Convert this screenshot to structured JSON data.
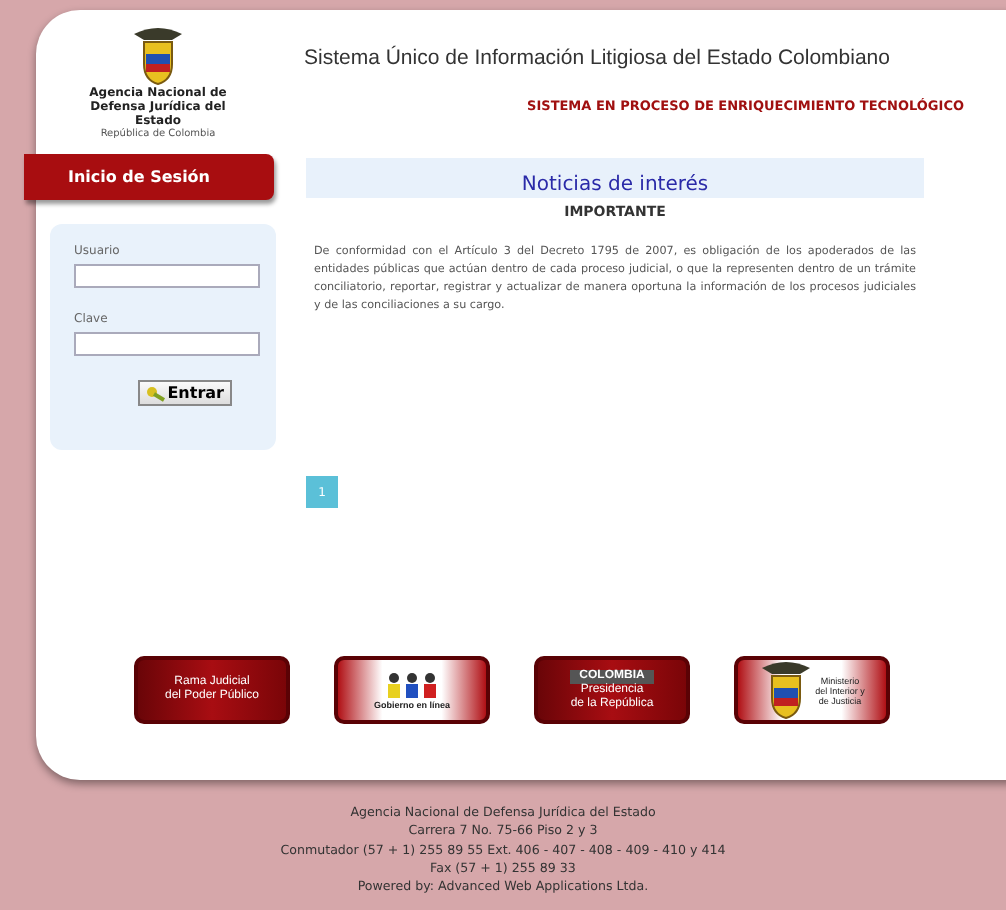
{
  "header": {
    "agency_name": "Agencia Nacional de Defensa Jurídica del Estado",
    "country": "República de Colombia",
    "title": "Sistema Único de Información Litigiosa del Estado Colombiano",
    "notice": "SISTEMA EN PROCESO DE ENRIQUECIMIENTO TECNOLÓGICO"
  },
  "login": {
    "title": "Inicio de Sesión",
    "fields": [
      {
        "label": "Usuario"
      },
      {
        "label": "Clave"
      }
    ],
    "button": "Entrar"
  },
  "news": {
    "title": "Noticias de interés",
    "heading": "IMPORTANTE",
    "body": "De conformidad con el Artículo 3 del Decreto 1795 de 2007, es obligación de los apoderados de las entidades públicas que actúan dentro de cada proceso judicial, o que la representen dentro de un trámite conciliatorio, reportar, registrar y actualizar de manera oportuna la información de los procesos judiciales y de las conciliaciones a su cargo.",
    "pages": [
      {
        "label": "1",
        "selected": true
      }
    ]
  },
  "banners": [
    {
      "kind": "photo",
      "lines": [
        "Rama Judicial",
        "del Poder Público"
      ]
    },
    {
      "kind": "figures",
      "lines": [
        "Gobierno en línea"
      ]
    },
    {
      "kind": "presidency",
      "lines": [
        "COLOMBIA",
        "Presidencia",
        "de la República"
      ]
    },
    {
      "kind": "shield",
      "lines": [
        "Ministerio",
        "del Interior y",
        "de Justicia"
      ]
    }
  ],
  "footer": [
    "Agencia Nacional de Defensa Jurídica del Estado",
    "Carrera 7 No. 75-66 Piso 2 y 3",
    "Conmutador (57 + 1) 255 89 55 Ext. 406 - 407 - 408 - 409 - 410 y 414",
    "Fax (57 + 1) 255 89 33",
    "Powered by: Advanced Web Applications Ltda."
  ]
}
